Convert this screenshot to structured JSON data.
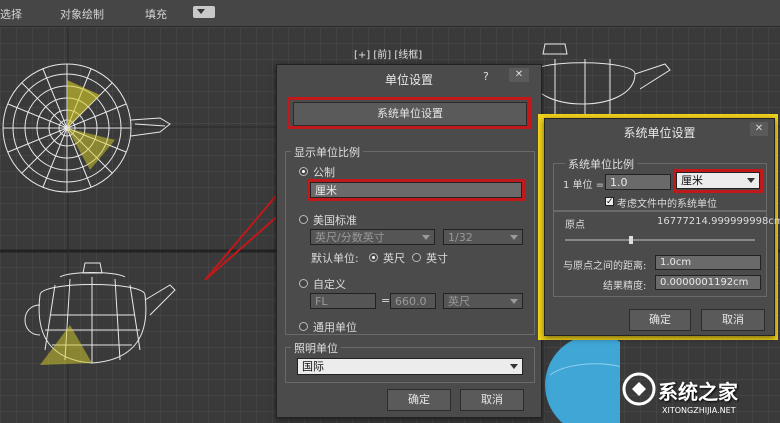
{
  "toolbar": {
    "item1": "选择",
    "item2": "对象绘制",
    "item3": "填充"
  },
  "viewport": {
    "front_label": "[+] [前] [线框]"
  },
  "unit_dialog": {
    "title": "单位设置",
    "help": "?",
    "close": "✕",
    "system_units_button": "系统单位设置",
    "display_group": "显示单位比例",
    "metric_label": "公制",
    "metric_value": "厘米",
    "us_label": "美国标准",
    "us_unit_value": "英尺/分数英寸",
    "us_fraction_value": "1/32",
    "default_unit_label": "默认单位:",
    "feet_label": "英尺",
    "inch_label": "英寸",
    "custom_label": "自定义",
    "custom_name_value": "FL",
    "equals": "=",
    "custom_amount_value": "660.0",
    "custom_unit_value": "英尺",
    "generic_label": "通用单位",
    "lighting_group": "照明单位",
    "lighting_value": "国际",
    "ok": "确定",
    "cancel": "取消"
  },
  "system_dialog": {
    "title": "系统单位设置",
    "close": "✕",
    "scale_group": "系统单位比例",
    "one_unit_label": "1 单位 =",
    "one_unit_value": "1.0",
    "unit_value": "厘米",
    "consider_file_label": "考虑文件中的系统单位",
    "origin_label": "原点",
    "origin_value": "16777214.999999998cm",
    "distance_label": "与原点之间的距离:",
    "distance_value": "1.0cm",
    "precision_label": "结果精度:",
    "precision_value": "0.0000001192cm",
    "ok": "确定",
    "cancel": "取消"
  },
  "watermark": {
    "logo_text": "系统之家",
    "url": "XITONGZHIJIA.NET"
  },
  "colors": {
    "highlight_red": "#c0181b",
    "dialog_yellow_border": "#f1d21c",
    "wire": "#e8e8e8",
    "face_yellow": "#d8cf2a"
  }
}
